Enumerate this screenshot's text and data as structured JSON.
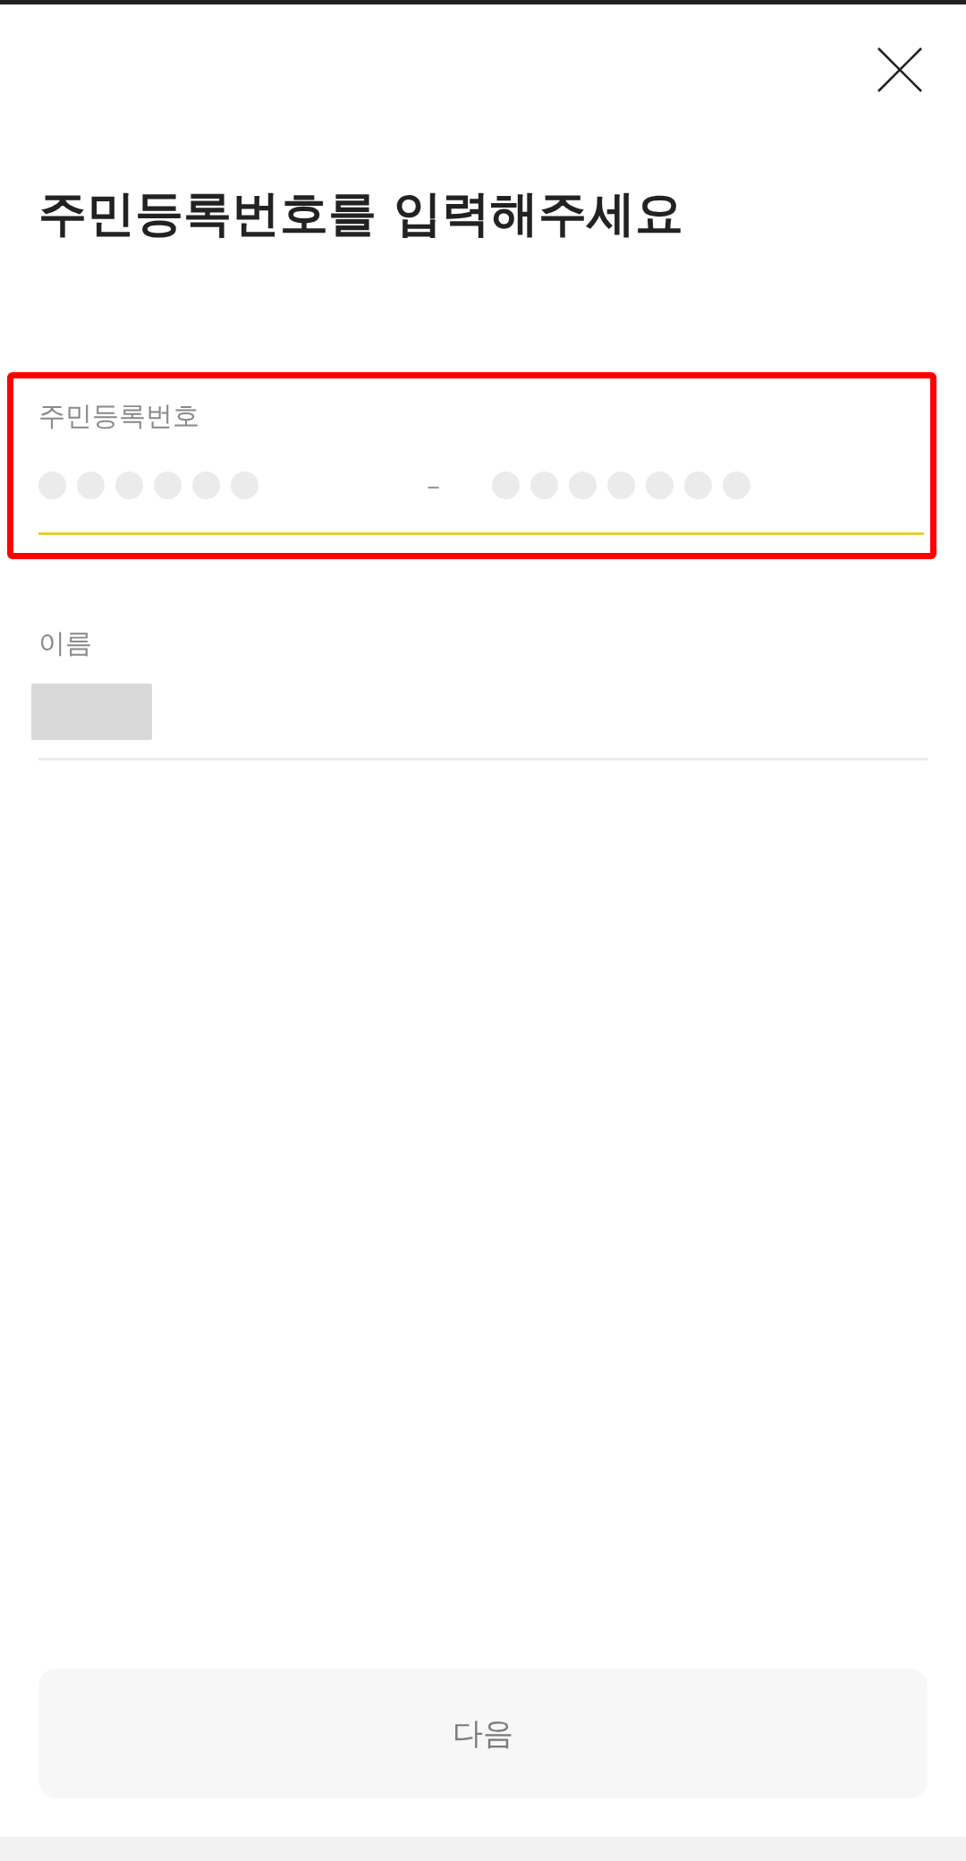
{
  "title": "주민등록번호를 입력해주세요",
  "rrn_field": {
    "label": "주민등록번호",
    "focused": true,
    "highlighted": true,
    "separator": "–",
    "front_dots": [
      {
        "filled": false
      },
      {
        "filled": false
      },
      {
        "filled": false
      },
      {
        "filled": false
      },
      {
        "filled": false
      },
      {
        "filled": false
      }
    ],
    "back_dots": [
      {
        "filled": false
      },
      {
        "filled": false
      },
      {
        "filled": false
      },
      {
        "filled": false
      },
      {
        "filled": false
      },
      {
        "filled": false
      },
      {
        "filled": false
      }
    ]
  },
  "name_field": {
    "label": "이름",
    "focused": false,
    "redacted": true
  },
  "next_button": {
    "label": "다음",
    "disabled": true
  }
}
